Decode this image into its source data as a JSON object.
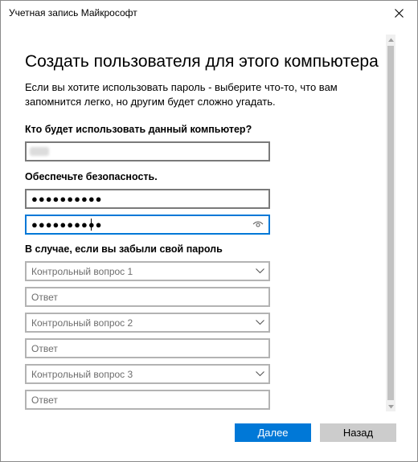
{
  "window": {
    "title": "Учетная запись Майкрософт"
  },
  "main": {
    "heading": "Создать пользователя для этого компьютера",
    "description": "Если вы хотите использовать пароль - выберите что-то, что вам запомнится легко, но другим будет сложно угадать.",
    "user_section": {
      "label": "Кто будет использовать данный компьютер?",
      "username_value": ""
    },
    "security_section": {
      "label": "Обеспечьте безопасность.",
      "password_value": "●●●●●●●●●●",
      "confirm_value": "●●●●●●●●●●"
    },
    "recovery_section": {
      "label": "В случае, если вы забыли свой пароль",
      "questions": [
        {
          "select_placeholder": "Контрольный вопрос 1",
          "answer_placeholder": "Ответ"
        },
        {
          "select_placeholder": "Контрольный вопрос 2",
          "answer_placeholder": "Ответ"
        },
        {
          "select_placeholder": "Контрольный вопрос 3",
          "answer_placeholder": "Ответ"
        }
      ]
    }
  },
  "footer": {
    "next_label": "Далее",
    "back_label": "Назад"
  },
  "icons": {
    "close": "close-icon",
    "eye": "eye-icon",
    "chevron": "chevron-down-icon"
  },
  "colors": {
    "accent": "#0078d7",
    "secondary_button": "#cccccc",
    "placeholder_text": "#6d6d6d"
  }
}
